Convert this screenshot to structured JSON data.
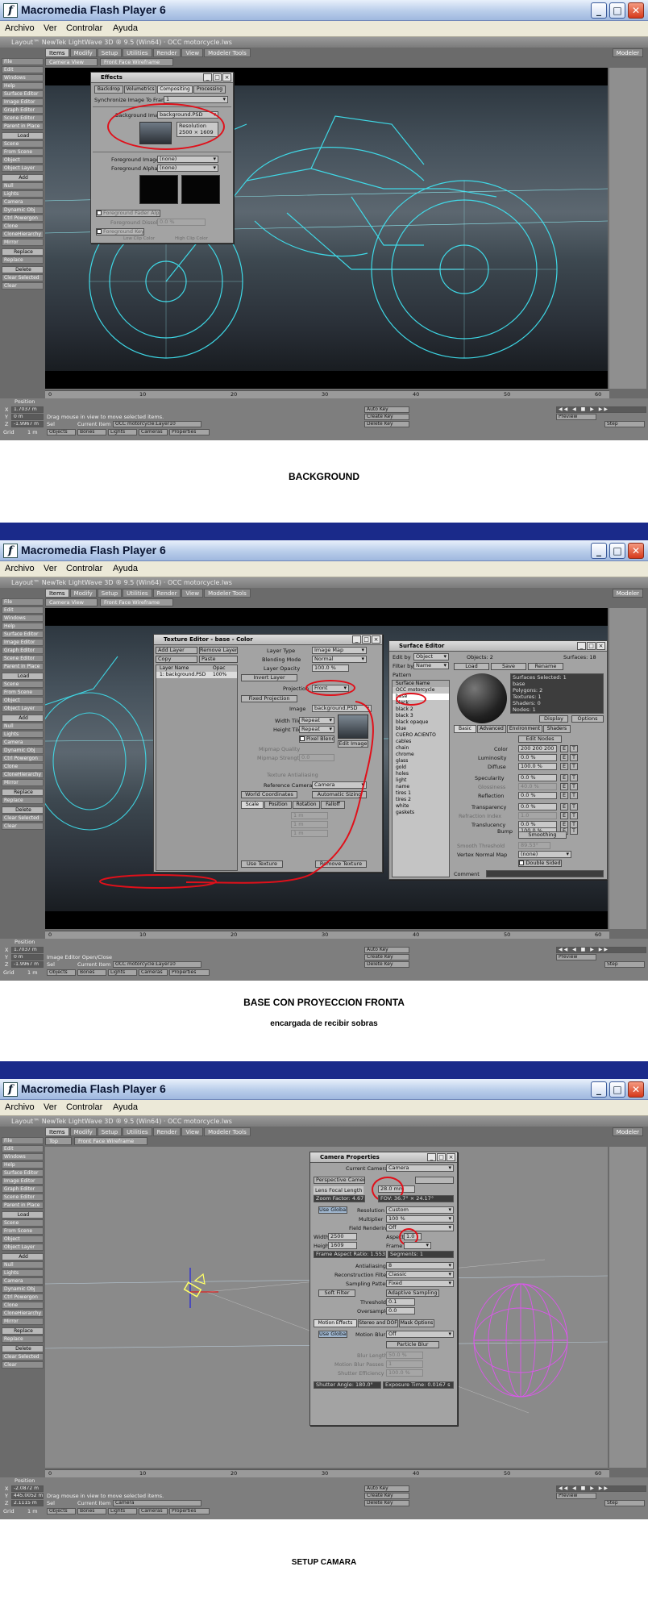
{
  "window": {
    "title": "Macromedia Flash Player 6",
    "menu": [
      "Archivo",
      "Ver",
      "Controlar",
      "Ayuda"
    ]
  },
  "lightwave": {
    "tabs": [
      "Items",
      "Modify",
      "Setup",
      "Utilities",
      "Render",
      "View",
      "Modeler Tools"
    ],
    "modeler_label": "Modeler",
    "sidebar": [
      "File",
      "Edit",
      "Windows",
      "Help",
      "Surface Editor",
      "Image Editor",
      "Graph Editor",
      "Scene Editor",
      "Parent in Place",
      "Load",
      "Scene",
      "From Scene",
      "Object",
      "Object Layer",
      "Add",
      "Null",
      "Lights",
      "Camera",
      "Dynamic Obj",
      "Ctrl Powergon",
      "Clone",
      "CloneHierarchy",
      "Mirror",
      "Replace",
      "Replace",
      "Delete",
      "Clear Selected",
      "Clear"
    ],
    "viewport_view": "Camera View",
    "viewport_mode": "Front Face Wireframe",
    "timeline_ticks": [
      "0",
      "10",
      "20",
      "30",
      "40",
      "50",
      "60"
    ],
    "position_label": "Position",
    "x_label": "X",
    "y_label": "Y",
    "z_label": "Z",
    "grid_label": "Grid",
    "grid_value": "1 m",
    "auto_key": "Auto Key",
    "create_key": "Create Key",
    "delete_key": "Delete Key",
    "preview": "Preview",
    "step": "Step",
    "objects_tab": "Objects",
    "bones_tab": "Bones",
    "lights_tab": "Lights",
    "cameras_tab": "Cameras",
    "properties_tab": "Properties",
    "sel_label": "Sel",
    "current_item_label": "Current Item"
  },
  "panel1": {
    "lw_title": "Layout™ NewTek LightWave 3D ® 9.5 (Win64) · OCC motorcycle.lws",
    "coords": [
      "1.7037 m",
      "0 m",
      "-1.9967 m"
    ],
    "status": "Drag mouse in view to move selected items.",
    "current_item": "OCC motorcycle:Layer10",
    "caption": "BACKGROUND",
    "effects": {
      "title": "Effects",
      "tabs": [
        "Backdrop",
        "Volumetrics",
        "Compositing",
        "Processing"
      ],
      "sync_label": "Synchronize Image To Frame",
      "sync_value": "1",
      "bg_label": "Background Image",
      "bg_value": "background.PSD",
      "resolution_label": "Resolution",
      "resolution_value": "2500 × 1609",
      "fg_label": "Foreground Image",
      "fg_value": "(none)",
      "fg_alpha_label": "Foreground Alpha",
      "fg_alpha_value": "(none)",
      "fade_label": "Foreground Fader Alpha",
      "dissolve_label": "Foreground Dissolve",
      "dissolve_value": "0.0 %",
      "key_label": "Foreground Key",
      "low_clip": "Low Clip Color",
      "high_clip": "High Clip Color"
    }
  },
  "panel2": {
    "lw_title": "Layout™ NewTek LightWave 3D ® 9.5 (Win64) · OCC motorcycle.lws",
    "coords": [
      "1.7037 m",
      "0 m",
      "-1.9967 m"
    ],
    "status": "Image Editor Open/Close",
    "current_item": "OCC motorcycle:Layer10",
    "caption": "BASE CON PROYECCION FRONTA",
    "subcaption": "encargada de recibir sobras",
    "texture": {
      "title": "Texture Editor - base - Color",
      "add_layer": "Add Layer",
      "remove_layer": "Remove Layer",
      "copy": "Copy",
      "paste": "Paste",
      "col_layer": "Layer Name",
      "col_opac": "Opac",
      "layer_row": "1: background.PSD",
      "layer_opac": "100%",
      "layer_type_label": "Layer Type",
      "layer_type": "Image Map",
      "blending_label": "Blending Mode",
      "blending": "Normal",
      "opacity_label": "Layer Opacity",
      "opacity": "100.0 %",
      "invert": "Invert Layer",
      "projection_label": "Projection",
      "projection": "Front",
      "fixed": "Fixed Projection",
      "image_label": "Image",
      "image": "background.PSD",
      "edit_image": "Edit Image",
      "width_tile_label": "Width Tile",
      "width_tile": "Repeat",
      "height_tile_label": "Height Tile",
      "height_tile": "Repeat",
      "pixel_blend": "Pixel Blending",
      "wrap_label": "Mipmap Quality",
      "strength_label": "Mipmap Strength",
      "strength": "0.0",
      "texture_label": "Texture Antialiasing",
      "ref_camera_label": "Reference Camera",
      "ref_camera": "Camera",
      "world_coords": "World Coordinates",
      "auto_sizing": "Automatic Sizing",
      "sub_tabs": [
        "Scale",
        "Position",
        "Rotation",
        "Falloff"
      ],
      "xyz": [
        "1 m",
        "1 m",
        "1 m"
      ],
      "use_texture": "Use Texture",
      "remove_texture": "Remove Texture"
    },
    "surface": {
      "title": "Surface Editor",
      "edit_by_label": "Edit by",
      "edit_by": "Object",
      "filter_label": "Filter by",
      "filter": "Name",
      "pattern_label": "Pattern",
      "objects_label": "Objects: 2",
      "surfaces_label": "Surfaces: 18",
      "load": "Load",
      "save": "Save",
      "rename": "Rename",
      "list_header": "Surface Name",
      "items": [
        "OCC motorcycle",
        "base",
        "black",
        "black 2",
        "black 3",
        "black opaque",
        "blue",
        "CUERO ACIENTO",
        "cables",
        "chain",
        "chrome",
        "glass",
        "gold",
        "holes",
        "light",
        "name",
        "tires 1",
        "tires 2",
        "white",
        "gaskets"
      ],
      "selected": "base",
      "info": [
        "Surfaces Selected: 1",
        "base",
        "Polygons: 2",
        "Textures: 1",
        "Shaders: 0",
        "Nodes: 1"
      ],
      "display": "Display",
      "options": "Options",
      "tabs": [
        "Basic",
        "Advanced",
        "Environment",
        "Shaders"
      ],
      "edit_nodes": "Edit Nodes",
      "props": [
        {
          "label": "Color",
          "value": "200 200 200"
        },
        {
          "label": "Luminosity",
          "value": "0.0 %"
        },
        {
          "label": "Diffuse",
          "value": "100.0 %"
        },
        {
          "label": "Specularity",
          "value": "0.0 %"
        },
        {
          "label": "Glossiness",
          "value": "40.0 %"
        },
        {
          "label": "Reflection",
          "value": "0.0 %"
        },
        {
          "label": "Transparency",
          "value": "0.0 %"
        },
        {
          "label": "Refraction Index",
          "value": "1.0"
        },
        {
          "label": "Translucency",
          "value": "0.0 %"
        },
        {
          "label": "Bump",
          "value": "100.0 %"
        }
      ],
      "smoothing": "Smoothing",
      "threshold_label": "Smooth Threshold",
      "threshold": "89.53°",
      "vertex_map_label": "Vertex Normal Map",
      "vertex_map": "(none)",
      "double_sided": "Double Sided",
      "comment_label": "Comment"
    }
  },
  "panel3": {
    "lw_title": "Layout™ NewTek LightWave 3D ® 9.5 (Win64) · OCC motorcycle.lws",
    "coords": [
      "-2.0872 m",
      "445.0052 m",
      "2.1115 m"
    ],
    "status": "Drag mouse in view to move selected items.",
    "current_item": "Camera",
    "viewport_view": "Top",
    "caption": "SETUP CAMARA",
    "camera": {
      "title": "Camera Properties",
      "current_label": "Current Camera",
      "current": "Camera",
      "type": "Perspective Camera",
      "lens_label": "Lens Focal Length",
      "lens": "28.0 mm",
      "zoom_label": "Zoom Factor: 4.67",
      "fov_label": "FOV: 36.7° × 24.17°",
      "use_global": "Use Global",
      "resolution_label": "Resolution",
      "resolution": "Custom",
      "multiplier_label": "Multiplier",
      "multiplier": "100 %",
      "field_label": "Field Rendering",
      "field": "Off",
      "width_label": "Width",
      "width": "2500",
      "height_label": "Height",
      "height": "1609",
      "aspect_label": "Aspect",
      "aspect": "1.0",
      "frame_label": "Frame",
      "frame_aspect": "Frame Aspect Ratio: 1.553",
      "segments": "Segments: 1",
      "aa_label": "Antialiasing",
      "aa": "8",
      "recon_label": "Reconstruction Filter",
      "recon": "Classic",
      "sampling_label": "Sampling Pattern",
      "sampling": "Fixed",
      "soft_filter": "Soft Filter",
      "adaptive": "Adaptive Sampling",
      "threshold_label": "Threshold",
      "threshold": "0.1",
      "oversample_label": "Oversample",
      "oversample": "0.0",
      "tabs": [
        "Motion Effects",
        "Stereo and DOF",
        "Mask Options"
      ],
      "motion_label": "Motion Blur",
      "motion": "Off",
      "particle_blur": "Particle Blur",
      "blur_length_label": "Blur Length",
      "blur_length": "50.0 %",
      "blur_passes_label": "Motion Blur Passes",
      "blur_passes": "1",
      "shutter_eff_label": "Shutter Efficiency",
      "shutter_eff": "100.0 %",
      "shutter_angle": "Shutter Angle: 180.0°",
      "exposure": "Exposure Time: 0.0167 s"
    }
  }
}
